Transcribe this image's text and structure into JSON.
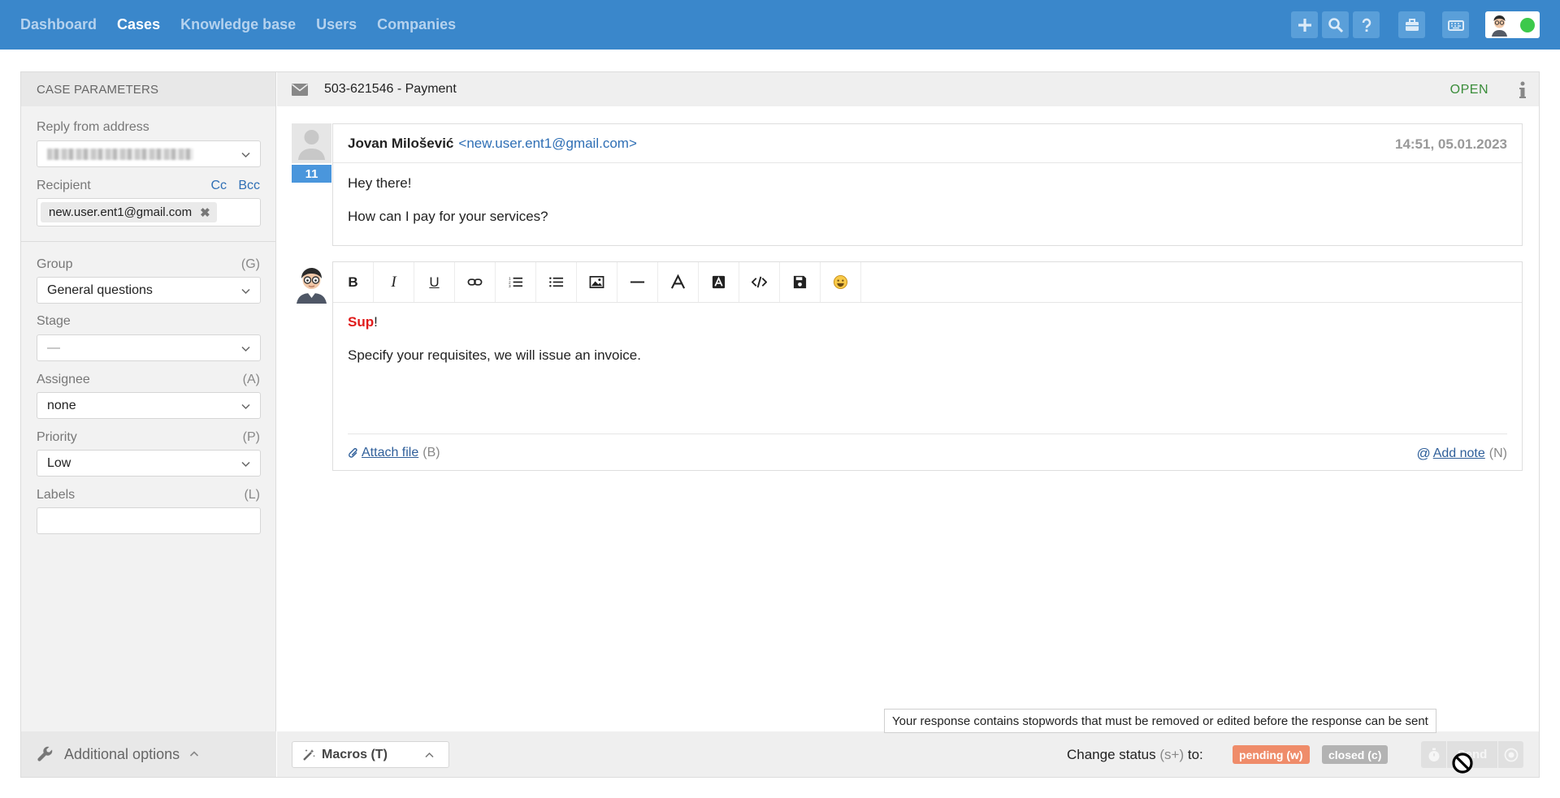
{
  "nav": {
    "items": [
      "Dashboard",
      "Cases",
      "Knowledge base",
      "Users",
      "Companies"
    ],
    "active": "Cases",
    "buttons": [
      "plus-icon",
      "search-icon",
      "help-icon",
      "briefcase-icon",
      "keyboard-icon"
    ]
  },
  "sidebar": {
    "header": "Case parameters",
    "reply_from_label": "Reply from address",
    "recipient_label": "Recipient",
    "cc": "Cc",
    "bcc": "Bcc",
    "recipient_tag": "new.user.ent1@gmail.com",
    "group_label": "Group",
    "group_hotkey": "(G)",
    "group_value": "General questions",
    "stage_label": "Stage",
    "stage_value": "—",
    "assignee_label": "Assignee",
    "assignee_hotkey": "(A)",
    "assignee_value": "none",
    "priority_label": "Priority",
    "priority_hotkey": "(P)",
    "priority_value": "Low",
    "labels_label": "Labels",
    "labels_hotkey": "(L)",
    "additional_options": "Additional options"
  },
  "case": {
    "title": "503-621546 - Payment",
    "status": "OPEN"
  },
  "message": {
    "count": "11",
    "sender": "Jovan Milošević",
    "email": "<new.user.ent1@gmail.com>",
    "time": "14:51, 05.01.2023",
    "lines": [
      "Hey there!",
      "How can I pay for your services?"
    ]
  },
  "editor": {
    "tools": [
      "bold",
      "italic",
      "underline",
      "link",
      "ordered-list",
      "bullet-list",
      "image",
      "horizontal-rule",
      "font-color",
      "background-color",
      "code",
      "save",
      "emoji"
    ],
    "tool_labels": {
      "bold": "B",
      "italic": "I",
      "underline": "U"
    },
    "stopword": "Sup",
    "after_stopword": "!",
    "line2": "Specify your requisites, we will issue an invoice.",
    "attach_label": "Attach file",
    "attach_hotkey": "(B)",
    "note_label": "Add note",
    "note_hotkey": "(N)"
  },
  "tooltip": "Your response contains stopwords that must be removed or edited before the response can be sent",
  "footer": {
    "macros": "Macros (T)",
    "change_status": "Change status",
    "change_status_hotkey": "(s+)",
    "to": "to:",
    "pending": "pending (w)",
    "closed": "closed (c)",
    "send": "Send"
  },
  "colors": {
    "topbar": "#3a87cb",
    "pending": "#ef8c6a",
    "closed": "#b3b3b3",
    "open": "#3a8d3a",
    "stopword": "#e01b1b"
  }
}
